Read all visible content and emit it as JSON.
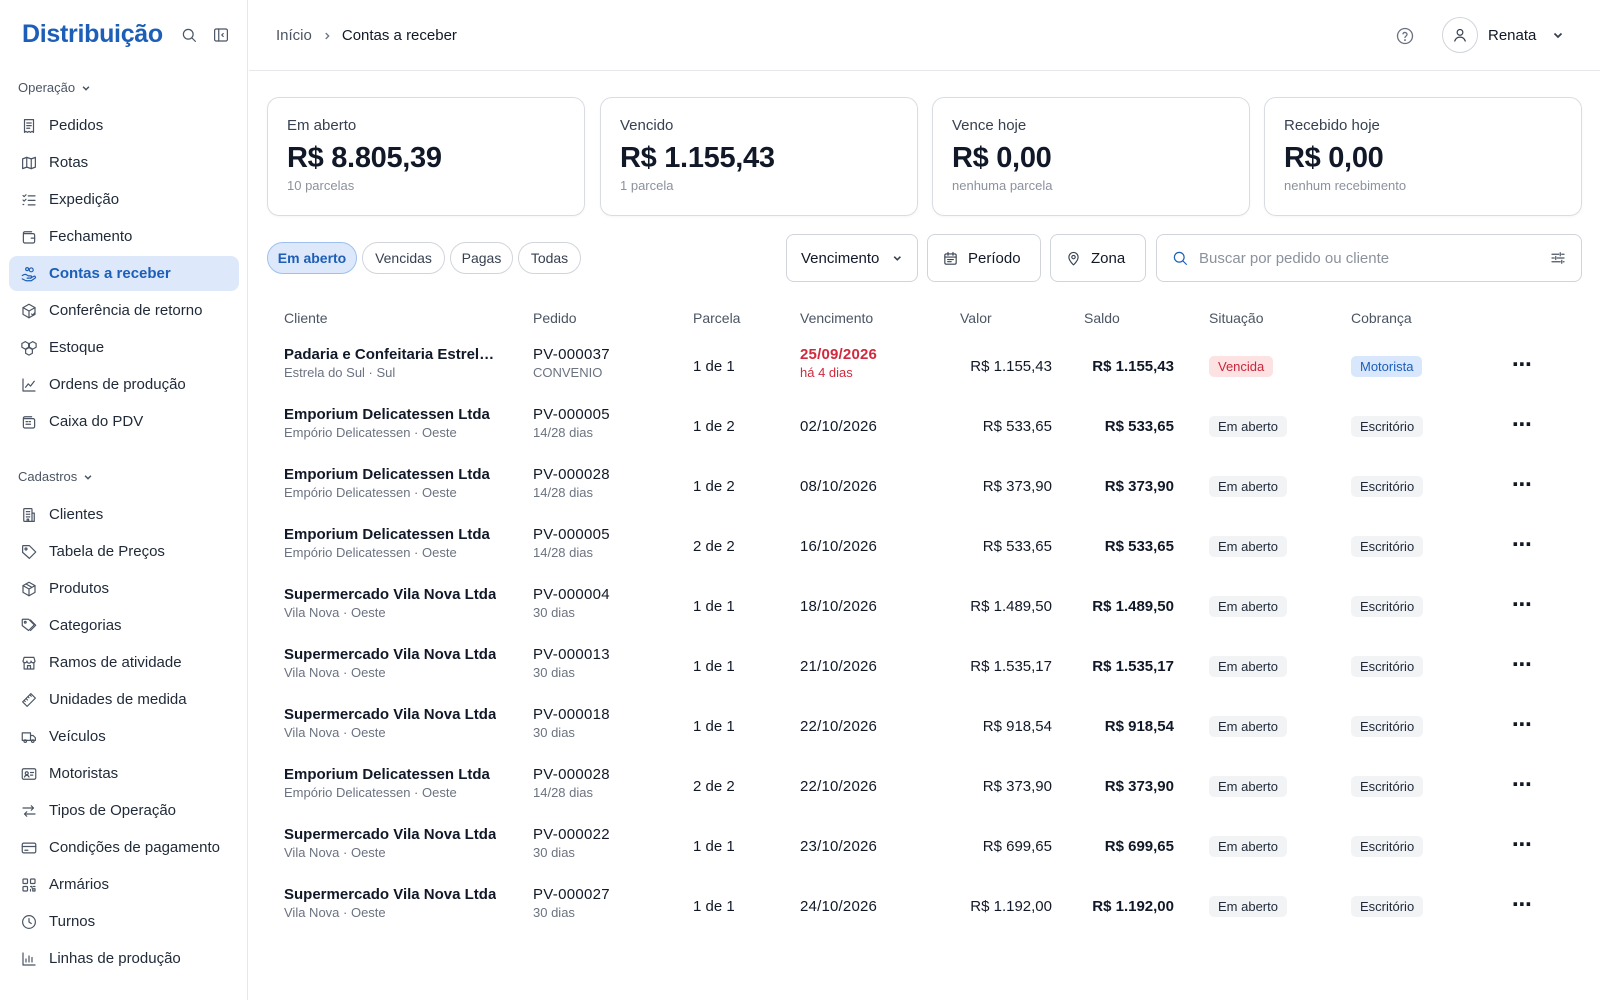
{
  "sidebar": {
    "brand": "Distribuição",
    "sections": [
      {
        "label": "Operação",
        "items": [
          {
            "label": "Pedidos",
            "icon": "receipt-icon"
          },
          {
            "label": "Rotas",
            "icon": "map-icon"
          },
          {
            "label": "Expedição",
            "icon": "list-checks-icon"
          },
          {
            "label": "Fechamento",
            "icon": "wallet-icon"
          },
          {
            "label": "Contas a receber",
            "icon": "hand-coins-icon",
            "active": true
          },
          {
            "label": "Conferência de retorno",
            "icon": "package-check-icon"
          },
          {
            "label": "Estoque",
            "icon": "boxes-icon"
          },
          {
            "label": "Ordens de produção",
            "icon": "chart-icon"
          },
          {
            "label": "Caixa do PDV",
            "icon": "cash-register-icon"
          }
        ]
      },
      {
        "label": "Cadastros",
        "items": [
          {
            "label": "Clientes",
            "icon": "building-icon"
          },
          {
            "label": "Tabela de Preços",
            "icon": "tag-icon"
          },
          {
            "label": "Produtos",
            "icon": "package-icon"
          },
          {
            "label": "Categorias",
            "icon": "tags-icon"
          },
          {
            "label": "Ramos de atividade",
            "icon": "store-icon"
          },
          {
            "label": "Unidades de medida",
            "icon": "ruler-icon"
          },
          {
            "label": "Veículos",
            "icon": "truck-icon"
          },
          {
            "label": "Motoristas",
            "icon": "id-card-icon"
          },
          {
            "label": "Tipos de Operação",
            "icon": "arrows-exchange-icon"
          },
          {
            "label": "Condições de pagamento",
            "icon": "credit-card-icon"
          },
          {
            "label": "Armários",
            "icon": "grid-icon"
          },
          {
            "label": "Turnos",
            "icon": "clock-icon"
          },
          {
            "label": "Linhas de produção",
            "icon": "bar-chart-icon"
          }
        ]
      }
    ]
  },
  "header": {
    "breadcrumb": [
      "Início",
      "Contas a receber"
    ],
    "user_name": "Renata"
  },
  "kpis": [
    {
      "label": "Em aberto",
      "value": "R$ 8.805,39",
      "sub": "10 parcelas"
    },
    {
      "label": "Vencido",
      "value": "R$ 1.155,43",
      "sub": "1 parcela"
    },
    {
      "label": "Vence hoje",
      "value": "R$ 0,00",
      "sub": "nenhuma parcela"
    },
    {
      "label": "Recebido hoje",
      "value": "R$ 0,00",
      "sub": "nenhum recebimento"
    }
  ],
  "filters": {
    "tabs": [
      {
        "label": "Em aberto",
        "active": true
      },
      {
        "label": "Vencidas"
      },
      {
        "label": "Pagas"
      },
      {
        "label": "Todas"
      }
    ],
    "sort_label": "Vencimento",
    "period_label": "Período",
    "zone_label": "Zona",
    "search_placeholder": "Buscar por pedido ou cliente"
  },
  "table": {
    "columns": [
      "Cliente",
      "Pedido",
      "Parcela",
      "Vencimento",
      "Valor",
      "Saldo",
      "Situação",
      "Cobrança"
    ],
    "rows": [
      {
        "client": "Padaria e Confeitaria Estrela Do Sul Ltda",
        "client_sub": "Estrela do Sul · Sul",
        "order": "PV-000037",
        "order_sub": "CONVENIO",
        "installment": "1 de 1",
        "due": "25/09/2026",
        "due_sub": "há 4 dias",
        "overdue": true,
        "value": "R$ 1.155,43",
        "balance": "R$ 1.155,43",
        "status": "Vencida",
        "collection": "Motorista"
      },
      {
        "client": "Emporium Delicatessen Ltda",
        "client_sub": "Empório Delicatessen · Oeste",
        "order": "PV-000005",
        "order_sub": "14/28 dias",
        "installment": "1 de 2",
        "due": "02/10/2026",
        "value": "R$ 533,65",
        "balance": "R$ 533,65",
        "status": "Em aberto",
        "collection": "Escritório"
      },
      {
        "client": "Emporium Delicatessen Ltda",
        "client_sub": "Empório Delicatessen · Oeste",
        "order": "PV-000028",
        "order_sub": "14/28 dias",
        "installment": "1 de 2",
        "due": "08/10/2026",
        "value": "R$ 373,90",
        "balance": "R$ 373,90",
        "status": "Em aberto",
        "collection": "Escritório"
      },
      {
        "client": "Emporium Delicatessen Ltda",
        "client_sub": "Empório Delicatessen · Oeste",
        "order": "PV-000005",
        "order_sub": "14/28 dias",
        "installment": "2 de 2",
        "due": "16/10/2026",
        "value": "R$ 533,65",
        "balance": "R$ 533,65",
        "status": "Em aberto",
        "collection": "Escritório"
      },
      {
        "client": "Supermercado Vila Nova Ltda",
        "client_sub": "Vila Nova · Oeste",
        "order": "PV-000004",
        "order_sub": "30 dias",
        "installment": "1 de 1",
        "due": "18/10/2026",
        "value": "R$ 1.489,50",
        "balance": "R$ 1.489,50",
        "status": "Em aberto",
        "collection": "Escritório"
      },
      {
        "client": "Supermercado Vila Nova Ltda",
        "client_sub": "Vila Nova · Oeste",
        "order": "PV-000013",
        "order_sub": "30 dias",
        "installment": "1 de 1",
        "due": "21/10/2026",
        "value": "R$ 1.535,17",
        "balance": "R$ 1.535,17",
        "status": "Em aberto",
        "collection": "Escritório"
      },
      {
        "client": "Supermercado Vila Nova Ltda",
        "client_sub": "Vila Nova · Oeste",
        "order": "PV-000018",
        "order_sub": "30 dias",
        "installment": "1 de 1",
        "due": "22/10/2026",
        "value": "R$ 918,54",
        "balance": "R$ 918,54",
        "status": "Em aberto",
        "collection": "Escritório"
      },
      {
        "client": "Emporium Delicatessen Ltda",
        "client_sub": "Empório Delicatessen · Oeste",
        "order": "PV-000028",
        "order_sub": "14/28 dias",
        "installment": "2 de 2",
        "due": "22/10/2026",
        "value": "R$ 373,90",
        "balance": "R$ 373,90",
        "status": "Em aberto",
        "collection": "Escritório"
      },
      {
        "client": "Supermercado Vila Nova Ltda",
        "client_sub": "Vila Nova · Oeste",
        "order": "PV-000022",
        "order_sub": "30 dias",
        "installment": "1 de 1",
        "due": "23/10/2026",
        "value": "R$ 699,65",
        "balance": "R$ 699,65",
        "status": "Em aberto",
        "collection": "Escritório"
      },
      {
        "client": "Supermercado Vila Nova Ltda",
        "client_sub": "Vila Nova · Oeste",
        "order": "PV-000027",
        "order_sub": "30 dias",
        "installment": "1 de 1",
        "due": "24/10/2026",
        "value": "R$ 1.192,00",
        "balance": "R$ 1.192,00",
        "status": "Em aberto",
        "collection": "Escritório"
      }
    ],
    "row_action": "⋯"
  },
  "colors": {
    "accent": "#1d5fb8",
    "accent_bg": "#dde9fb",
    "danger": "#d1293d",
    "danger_bg": "#fde2e4"
  }
}
